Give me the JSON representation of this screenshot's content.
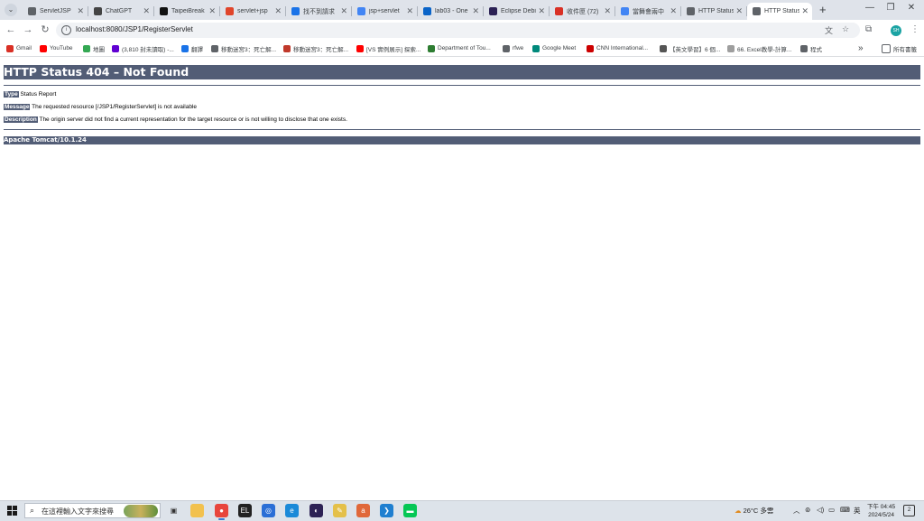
{
  "browser": {
    "tabs": [
      {
        "title": "ServletJSP",
        "icon": "globe-icon",
        "color": "#5f6368"
      },
      {
        "title": "ChatGPT",
        "icon": "chatgpt-icon",
        "color": "#444444"
      },
      {
        "title": "TaipeiBreak",
        "icon": "github-icon",
        "color": "#111111"
      },
      {
        "title": "servlet+jsp",
        "icon": "c-icon",
        "color": "#e0452b"
      },
      {
        "title": "找不到請求",
        "icon": "translate-icon",
        "color": "#1a73e8"
      },
      {
        "title": "jsp+servlet",
        "icon": "google-icon",
        "color": "#4285f4"
      },
      {
        "title": "lab03 - One",
        "icon": "onedrive-icon",
        "color": "#0a64c8"
      },
      {
        "title": "Eclipse Debi",
        "icon": "eclipse-icon",
        "color": "#2c2255"
      },
      {
        "title": "收件匣 (72)",
        "icon": "gmail-icon",
        "color": "#d93025"
      },
      {
        "title": "當舞會兩中",
        "icon": "google-icon",
        "color": "#4285f4"
      },
      {
        "title": "HTTP Status",
        "icon": "globe-icon",
        "color": "#5f6368"
      },
      {
        "title": "HTTP Status",
        "icon": "globe-icon",
        "color": "#5f6368",
        "active": true
      }
    ],
    "url": "localhost:8080/JSP1/RegisterServlet",
    "bookmarks": [
      {
        "label": "Gmail",
        "icon": "gmail-icon",
        "color": "#d93025"
      },
      {
        "label": "YouTube",
        "icon": "youtube-icon",
        "color": "#ff0000"
      },
      {
        "label": "地圖",
        "icon": "maps-icon",
        "color": "#34a853"
      },
      {
        "label": "(3,810 封未讀取) -...",
        "icon": "yahoo-mail-icon",
        "color": "#6001d2"
      },
      {
        "label": "翻譯",
        "icon": "translate-icon",
        "color": "#1a73e8"
      },
      {
        "label": "移動迷宮3：死亡解...",
        "icon": "globe-icon",
        "color": "#5f6368"
      },
      {
        "label": "移動迷宮3：死亡解...",
        "icon": "bookmark-icon",
        "color": "#c0392b"
      },
      {
        "label": "[VS 實例展示] 探索...",
        "icon": "youtube-icon",
        "color": "#ff0000"
      },
      {
        "label": "Department of Tou...",
        "icon": "dept-icon",
        "color": "#2e7d32"
      },
      {
        "label": "rfwe",
        "icon": "globe-icon",
        "color": "#5f6368"
      },
      {
        "label": "Google Meet",
        "icon": "meet-icon",
        "color": "#00897b"
      },
      {
        "label": "CNN International...",
        "icon": "cnn-icon",
        "color": "#cc0000"
      },
      {
        "label": "【英文學習】6 個...",
        "icon": "bookmark-icon",
        "color": "#555555"
      },
      {
        "label": "66. Excel教學-計算...",
        "icon": "page-icon",
        "color": "#9e9e9e"
      },
      {
        "label": "程式",
        "icon": "folder-icon",
        "color": "#5f6368"
      }
    ],
    "all_bookmarks": "所有書籤"
  },
  "page": {
    "title": "HTTP Status 404 – Not Found",
    "type_label": "Type",
    "type_value": "Status Report",
    "message_label": "Message",
    "message_value": "The requested resource [/JSP1/RegisterServlet] is not available",
    "description_label": "Description",
    "description_value": "The origin server did not find a current representation for the target resource or is not willing to disclose that one exists.",
    "footer": "Apache Tomcat/10.1.24"
  },
  "taskbar": {
    "search_placeholder": "在這裡輸入文字來搜尋",
    "weather": "26°C 多雲",
    "ime": "英",
    "time": "下午 04:45",
    "date": "2024/5/24",
    "notification_count": "2"
  }
}
